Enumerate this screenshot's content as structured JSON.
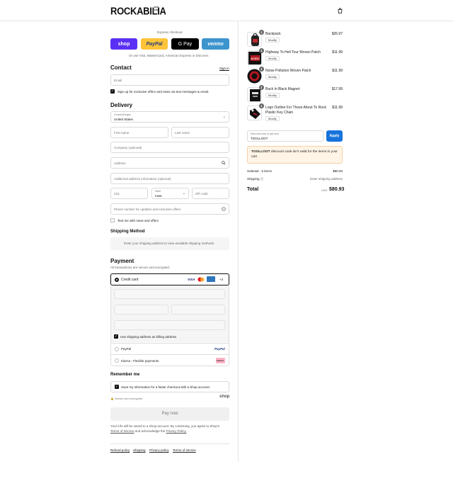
{
  "brand": {
    "name": "ROCKABILIA",
    "sub": "EST 1991"
  },
  "express": {
    "title": "Express checkout",
    "buttons": [
      "shop",
      "PayPal",
      "G Pay",
      "venmo"
    ],
    "alt_text": "Or use Visa, MasterCard, American Express or Discover."
  },
  "contact": {
    "heading": "Contact",
    "sign_in": "Sign in",
    "email_placeholder": "Email",
    "news_label": "Sign up for exclusive offers and news via text messages & email."
  },
  "delivery": {
    "heading": "Delivery",
    "country_label": "Country/Region",
    "country_value": "United States",
    "first_name": "First name",
    "last_name": "Last name",
    "company": "Company (optional)",
    "address": "Address",
    "address2": "Additional address information (optional)",
    "city": "City",
    "state_label": "State",
    "state_value": "Iowa",
    "zip": "ZIP code",
    "phone": "Phone number for updates and exclusive offers",
    "text_me": "Text me with news and offers"
  },
  "shipping": {
    "heading": "Shipping Method",
    "notice": "Enter your shipping address to view available shipping methods."
  },
  "payment": {
    "heading": "Payment",
    "sub": "All transactions are secure and encrypted.",
    "credit_card": "Credit card",
    "more_cards": "+4",
    "billing_same": "Use shipping address as billing address",
    "paypal": "PayPal",
    "paypal_logo": "PayPal",
    "klarna": "Klarna - Flexible payments",
    "klarna_logo": "Klarna."
  },
  "remember": {
    "heading": "Remember me",
    "save_label": "Save my information for a faster checkout with a Shop account",
    "secure": "Secure and encrypted",
    "shop_logo": "shop"
  },
  "pay_now": "Pay now",
  "legal": {
    "line1": "Your info will be saved to a Shop account. By continuing, you agree to Shop's",
    "terms": "Terms of Service",
    "mid": "and acknowledge the",
    "privacy": "Privacy Policy."
  },
  "footer_links": [
    "Refund policy",
    "Shipping",
    "Privacy policy",
    "Terms of service"
  ],
  "cart": {
    "items": [
      {
        "name": "Backpack",
        "name2": "",
        "variant": "Modify",
        "qty": "1",
        "price": "$26.97"
      },
      {
        "name": "Highway To Hell Tour Woven Patch",
        "name2": "",
        "variant": "Modify",
        "qty": "1",
        "price": "$11.99"
      },
      {
        "name": "Noise Pollution Woven Patch",
        "name2": "",
        "variant": "Modify",
        "qty": "1",
        "price": "$11.99"
      },
      {
        "name": "Back In Black Magnet",
        "name2": "",
        "variant": "Modify",
        "qty": "1",
        "price": "$17.99"
      },
      {
        "name": "Logo Outline For Those About To Rock",
        "name2": "Plastic Key Chain",
        "variant": "Modify",
        "qty": "1",
        "price": "$11.99"
      }
    ],
    "discount_label": "Discount code or gift card",
    "discount_value": "TOOLLOOT",
    "apply": "Apply",
    "error_code": "TOOLLOOT",
    "error_rest": "discount code isn't valid for the items in your",
    "error_rest2": "cart",
    "subtotal_label": "Subtotal · 5 items",
    "subtotal_value": "$80.93",
    "shipping_label": "Shipping",
    "shipping_value": "Enter shipping address",
    "total_label": "Total",
    "currency": "USD",
    "total_value": "$80.93"
  }
}
